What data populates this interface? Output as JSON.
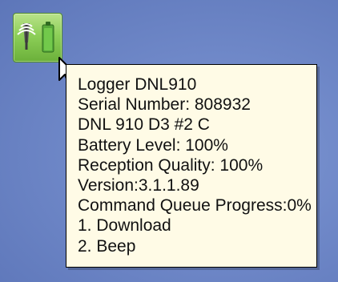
{
  "tooltip": {
    "lines": [
      "Logger DNL910",
      "Serial Number: 808932",
      "DNL 910 D3 #2 C",
      "Battery Level: 100%",
      "Reception Quality: 100%",
      "Version:3.1.1.89",
      "Command Queue Progress:0%",
      "1. Download",
      "2. Beep"
    ]
  },
  "icons": {
    "tray": "logger-battery-icon",
    "pointer": "cursor-arrow-icon"
  },
  "colors": {
    "desktop": "#6d86c7",
    "tooltip_bg": "#fffbe6",
    "tooltip_border": "#000000",
    "icon_green": "#8dcf58"
  }
}
